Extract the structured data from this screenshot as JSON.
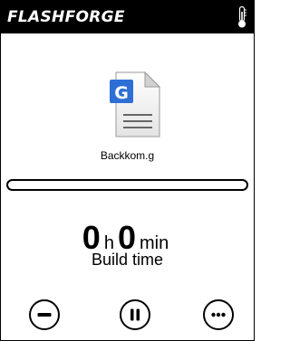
{
  "header": {
    "brand": "FLASHFORGE",
    "temperature_icon": "thermometer-icon"
  },
  "file": {
    "icon": "google-document-file-icon",
    "badge_letter": "G",
    "name": "Backkom.g",
    "accent_color": "#2e6fd6"
  },
  "progress": {
    "fraction": 0
  },
  "build_time": {
    "hours": "0",
    "hours_unit": "h",
    "minutes": "0",
    "minutes_unit": "min",
    "label": "Build time"
  },
  "controls": {
    "stop_icon": "minus-circle-icon",
    "pause_icon": "pause-circle-icon",
    "more_icon": "more-circle-icon"
  }
}
